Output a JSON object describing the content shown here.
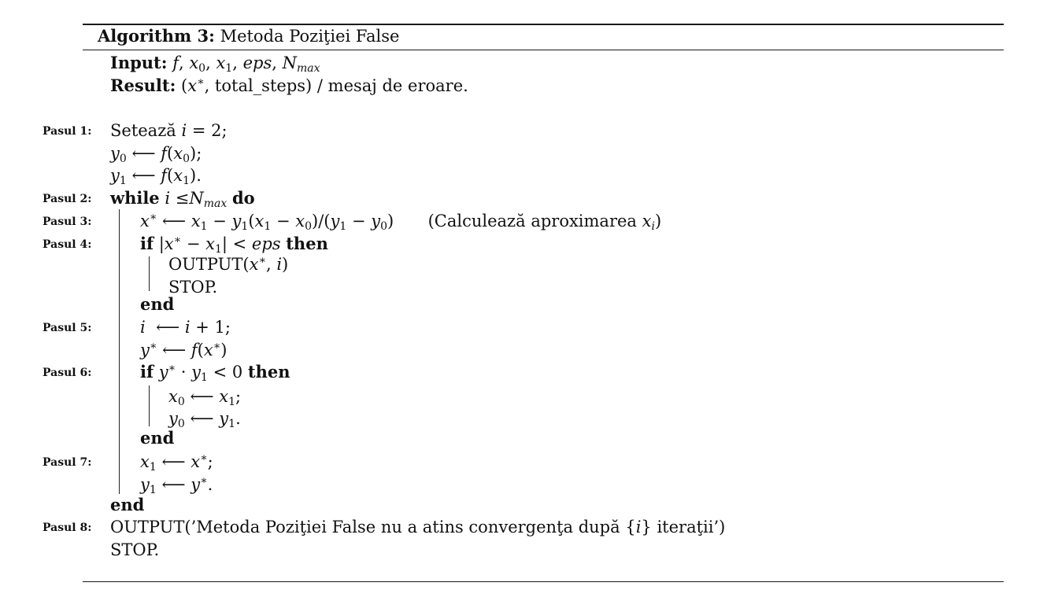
{
  "header": {
    "algo_label": "Algorithm 3:",
    "algo_title": "Metoda Poziţiei False"
  },
  "io": {
    "input_label": "Input:",
    "input_vars": [
      "f",
      "x",
      "0",
      "x",
      "1",
      "eps",
      "N",
      "max"
    ],
    "result_label": "Result:",
    "result_text_a": "(x",
    "result_text_b": ", total_steps) / mesaj de eroare."
  },
  "steps": [
    "Pasul 1:",
    "Pasul 2:",
    "Pasul 3:",
    "Pasul 4:",
    "Pasul 5:",
    "Pasul 6:",
    "Pasul 7:",
    "Pasul 8:"
  ],
  "keywords": {
    "while": "while",
    "do": "do",
    "if": "if",
    "then": "then",
    "end": "end"
  },
  "text": {
    "seteaza": "Setează",
    "i_eq_2": " = 2;",
    "calc_note": "(Calculează aproximarea",
    "output": "OUTPUT(",
    "stop": "STOP.",
    "final_output_a": "OUTPUT(’Metoda Poziţiei False nu a atins convergenţa după {",
    "final_output_b": "} iteraţii’)",
    "final_stop": "STOP."
  }
}
